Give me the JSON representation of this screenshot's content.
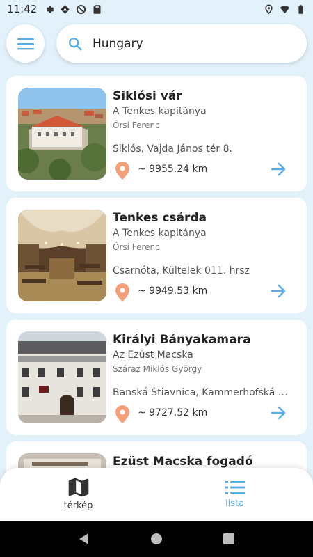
{
  "status_bar": {
    "time": "11:42",
    "left_icons": [
      "settings-icon",
      "app-icon",
      "vpn-icon",
      "sd-card-icon"
    ],
    "right_icons": [
      "location-icon",
      "wifi-icon",
      "battery-icon"
    ]
  },
  "search": {
    "value": "Hungary",
    "placeholder": ""
  },
  "places": [
    {
      "title": "Siklósi vár",
      "subtitle": "A Tenkes kapitánya",
      "author": "Örsi Ferenc",
      "address": "Siklós, Vajda János tér 8.",
      "distance": "~ 9955.24 km"
    },
    {
      "title": "Tenkes csárda",
      "subtitle": "A Tenkes kapitánya",
      "author": "Örsi Ferenc",
      "address": "Csarnóta, Kültelek 011. hrsz",
      "distance": "~ 9949.53 km"
    },
    {
      "title": "Királyi Bányakamara",
      "subtitle": "Az Ezüst Macska",
      "author": "Száraz Miklós György",
      "address": "Banská Štiavnica, Kammerhofská 1...",
      "distance": "~ 9727.52 km"
    },
    {
      "title": "Ezüst Macska fogadó",
      "subtitle": "",
      "author": "",
      "address": "",
      "distance": ""
    }
  ],
  "bottom_nav": {
    "map_label": "térkép",
    "list_label": "lista",
    "active": "lista"
  },
  "colors": {
    "accent": "#5aaee8",
    "pin": "#f4a07a",
    "background": "#e3f1fb"
  }
}
